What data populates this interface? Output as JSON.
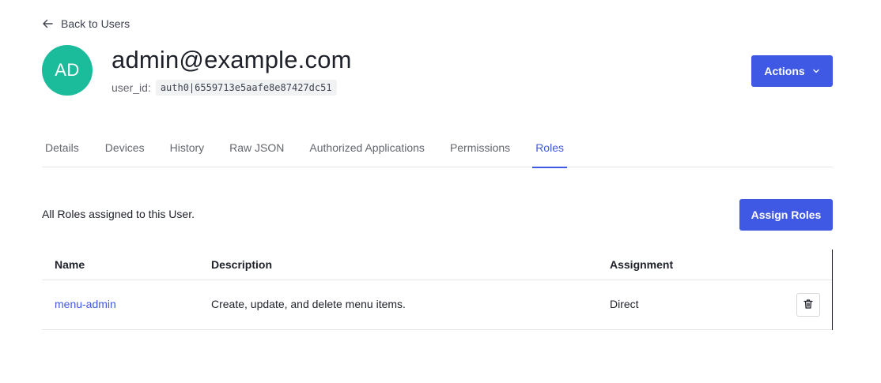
{
  "back_link": {
    "label": "Back to Users",
    "icon": "arrow-left-icon"
  },
  "user": {
    "initials": "AD",
    "email": "admin@example.com",
    "user_id_label": "user_id:",
    "user_id_value": "auth0|6559713e5aafe8e87427dc51",
    "avatar_color": "#1bbc9b"
  },
  "actions_button": {
    "label": "Actions",
    "icon": "chevron-down-icon"
  },
  "tabs": [
    {
      "label": "Details",
      "active": false
    },
    {
      "label": "Devices",
      "active": false
    },
    {
      "label": "History",
      "active": false
    },
    {
      "label": "Raw JSON",
      "active": false
    },
    {
      "label": "Authorized Applications",
      "active": false
    },
    {
      "label": "Permissions",
      "active": false
    },
    {
      "label": "Roles",
      "active": true
    }
  ],
  "roles_section": {
    "description": "All Roles assigned to this User.",
    "assign_button_label": "Assign Roles"
  },
  "roles_table": {
    "headers": {
      "name": "Name",
      "description": "Description",
      "assignment": "Assignment"
    },
    "rows": [
      {
        "name": "menu-admin",
        "description": "Create, update, and delete menu items.",
        "assignment": "Direct",
        "action_icon": "trash-icon"
      }
    ]
  },
  "colors": {
    "accent": "#3f59e4",
    "text": "#1e212a",
    "muted": "#65676e",
    "border": "#e3e4e6"
  }
}
